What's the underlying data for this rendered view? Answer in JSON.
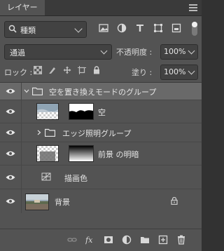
{
  "panel": {
    "tab_label": "レイヤー"
  },
  "filter": {
    "kind_label": "種類"
  },
  "blend": {
    "mode": "通過"
  },
  "opacity": {
    "label": "不透明度 :",
    "value": "100%"
  },
  "lock": {
    "label": "ロック :"
  },
  "fill": {
    "label": "塗り :",
    "value": "100%"
  },
  "layers": [
    {
      "type": "group",
      "name": "空を置き換えモードのグループ",
      "expanded": true,
      "selected": true
    },
    {
      "type": "layer",
      "name": "空"
    },
    {
      "type": "group",
      "name": "エッジ照明グループ",
      "expanded": false
    },
    {
      "type": "layer",
      "name": "前景 の明暗"
    },
    {
      "type": "adjustment",
      "name": "描画色"
    },
    {
      "type": "background",
      "name": "背景",
      "locked": true
    }
  ],
  "colors": {
    "panel_bg": "#535353",
    "selected_row": "#696969",
    "field_bg": "#424242"
  }
}
